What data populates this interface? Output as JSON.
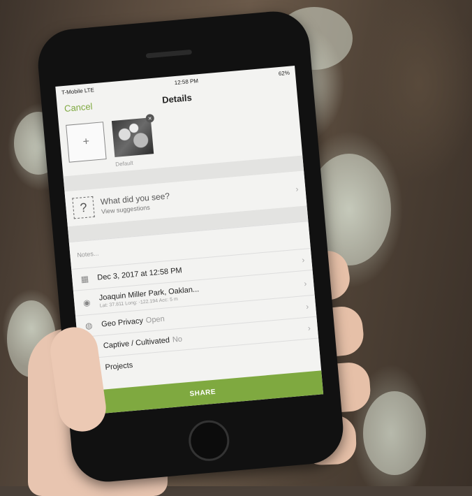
{
  "status": {
    "carrier": "T-Mobile  LTE",
    "time": "12:58 PM",
    "battery": "62%"
  },
  "nav": {
    "cancel_label": "Cancel",
    "title": "Details"
  },
  "photos": {
    "add_label": "+",
    "default_label": "Default"
  },
  "species": {
    "question": "What did you see?",
    "subtitle": "View suggestions"
  },
  "notes_placeholder": "Notes...",
  "rows": {
    "date": "Dec 3, 2017 at 12:58 PM",
    "location": "Joaquin Miller Park, Oaklan...",
    "location_sub": "Lat: 37.811  Long: -122.194  Acc: 5 m",
    "geo_privacy_label": "Geo Privacy",
    "geo_privacy_value": "Open",
    "captive_label": "Captive / Cultivated",
    "captive_value": "No",
    "projects_label": "Projects"
  },
  "share_label": "SHARE",
  "colors": {
    "accent": "#7fa940"
  },
  "icons": [
    "calendar-icon",
    "location-pin-icon",
    "globe-icon",
    "captive-icon",
    "projects-icon",
    "chevron-right-icon"
  ]
}
